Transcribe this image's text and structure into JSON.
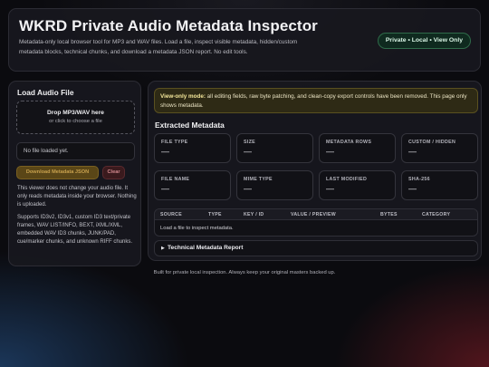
{
  "header": {
    "title": "WKRD Private Audio Metadata Inspector",
    "description": "Metadata-only local browser tool for MP3 and WAV files. Load a file, inspect visible metadata, hidden/custom metadata blocks, technical chunks, and download a metadata JSON report. No edit tools.",
    "badge": "Private • Local • View Only"
  },
  "load_panel": {
    "title": "Load Audio File",
    "drop_title": "Drop MP3/WAV here",
    "drop_subtitle": "or click to choose a file",
    "file_status": "No file loaded yet.",
    "download_button": "Download Metadata JSON",
    "clear_button": "Clear",
    "note_privacy": "This viewer does not change your audio file. It only reads metadata inside your browser. Nothing is uploaded.",
    "note_supports": "Supports ID3v2, ID3v1, custom ID3 text/private frames, WAV LIST/INFO, BEXT, iXML/XML, embedded WAV ID3 chunks, JUNK/PAD, cue/marker chunks, and unknown RIFF chunks."
  },
  "main": {
    "notice_strong": "View-only mode:",
    "notice_text": " all editing fields, raw byte patching, and clean-copy export controls have been removed. This page only shows metadata.",
    "section_title": "Extracted Metadata",
    "cards": [
      {
        "label": "FILE TYPE",
        "value": "—"
      },
      {
        "label": "SIZE",
        "value": "—"
      },
      {
        "label": "METADATA ROWS",
        "value": "—"
      },
      {
        "label": "CUSTOM / HIDDEN",
        "value": "—"
      },
      {
        "label": "FILE NAME",
        "value": "—"
      },
      {
        "label": "MIME TYPE",
        "value": "—"
      },
      {
        "label": "LAST MODIFIED",
        "value": "—"
      },
      {
        "label": "SHA-256",
        "value": "—"
      }
    ],
    "table": {
      "columns": [
        "SOURCE",
        "TYPE",
        "KEY / ID",
        "VALUE / PREVIEW",
        "BYTES",
        "CATEGORY"
      ],
      "empty_message": "Load a file to inspect metadata."
    },
    "report": {
      "arrow": "▶",
      "title": "Technical Metadata Report"
    }
  },
  "footer": "Built for private local inspection. Always keep your original masters backed up.",
  "colors": {
    "accent_gold": "#c9a24f",
    "badge_green": "#2f6b4a",
    "notice_yellow": "#f4e79a",
    "clear_red": "#d28a8f"
  }
}
